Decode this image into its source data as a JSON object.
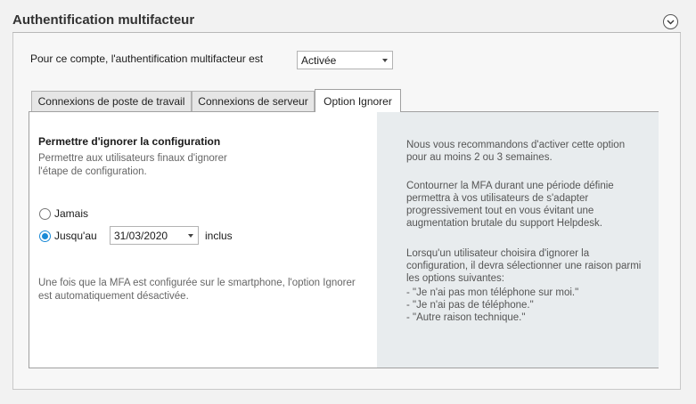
{
  "section": {
    "title": "Authentification multifacteur",
    "collapse_icon": "chevron-down-icon"
  },
  "mfa": {
    "label": "Pour ce compte, l'authentification multifacteur est",
    "status_value": "Activée"
  },
  "tabs": [
    {
      "label": "Connexions de poste de travail",
      "active": false
    },
    {
      "label": "Connexions de serveur",
      "active": false
    },
    {
      "label": "Option Ignorer",
      "active": true
    }
  ],
  "option_ignorer": {
    "title": "Permettre d'ignorer la configuration",
    "description": "Permettre aux utilisateurs finaux d'ignorer l'étape de configuration.",
    "radio_never": "Jamais",
    "radio_until": "Jusqu'au",
    "date_value": "31/03/2020",
    "inclusive_label": "inclus",
    "footnote": "Une fois que la MFA est configurée sur le smartphone, l'option Ignorer est automatiquement désactivée."
  },
  "info": {
    "p1": "Nous vous recommandons d'activer cette option pour au moins 2 ou 3 semaines.",
    "p2": "Contourner la MFA durant une période définie permettra à vos utilisateurs de s'adapter progressivement tout en vous évitant une augmentation brutale du support Helpdesk.",
    "p3_intro": "Lorsqu'un utilisateur choisira d'ignorer la configuration, il devra sélectionner une raison parmi les options suivantes:",
    "reasons": [
      "- \"Je n'ai pas mon téléphone sur moi.\"",
      "- \"Je n'ai pas de téléphone.\"",
      "- \"Autre raison technique.\""
    ]
  },
  "colors": {
    "accent": "#1a8ad6",
    "info_bg": "#e8ecee"
  }
}
